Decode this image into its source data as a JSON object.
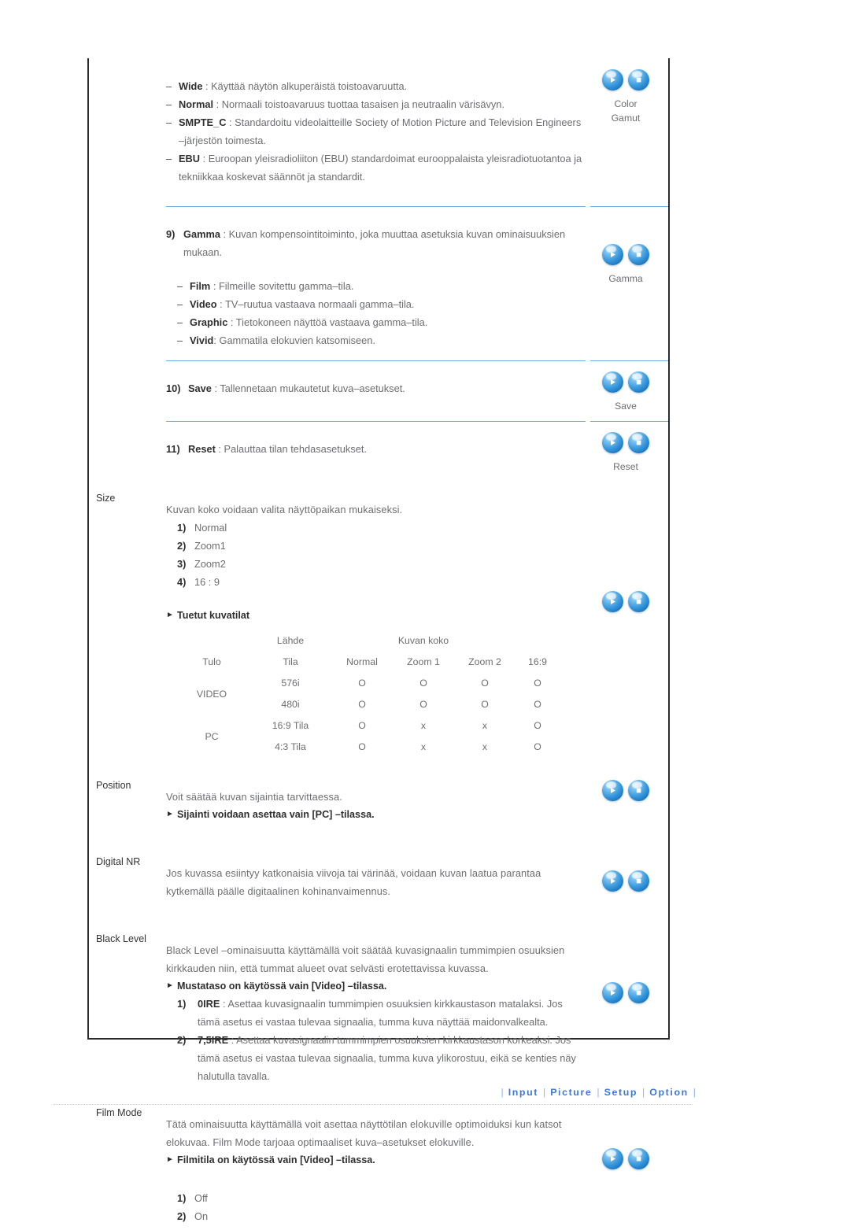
{
  "document": {
    "language": "fi",
    "accent_color": "#6aa9e9",
    "link_color": "#3c78d8"
  },
  "sections": [
    {
      "id": "color-gamut",
      "label": "",
      "icons": {
        "caption_line1": "Color",
        "caption_line2": "Gamut",
        "play": "play-icon",
        "stop": "stop-icon"
      },
      "items": [
        {
          "kind": "dash",
          "term": "Wide",
          "sep": " : ",
          "text": "Käyttää näytön alkuperäistä toistoavaruutta."
        },
        {
          "kind": "dash",
          "term": "Normal",
          "sep": " : ",
          "text": "Normaali toistoavaruus tuottaa tasaisen ja neutraalin värisävyn."
        },
        {
          "kind": "dash",
          "term": "SMPTE_C",
          "sep": " : ",
          "text": "Standardoitu videolaitteille Society of Motion Picture and Television Engineers –järjestön toimesta."
        },
        {
          "kind": "dash",
          "term": "EBU",
          "sep": " : ",
          "text": "Euroopan yleisradioliiton (EBU) standardoimat eurooppalaista yleisradiotuotantoa ja tekniikkaa koskevat säännöt ja standardit."
        }
      ]
    },
    {
      "id": "gamma",
      "label": "",
      "icons": {
        "caption_line1": "Gamma",
        "caption_line2": "",
        "play": "play-icon",
        "stop": "stop-icon"
      },
      "heading": {
        "num": "9)",
        "term": "Gamma",
        "sep": " : ",
        "text": "Kuvan kompensointitoiminto, joka muuttaa asetuksia kuvan ominaisuuksien mukaan."
      },
      "items": [
        {
          "kind": "dash",
          "term": "Film",
          "sep": " : ",
          "text": "Filmeille sovitettu gamma–tila."
        },
        {
          "kind": "dash",
          "term": "Video",
          "sep": " : ",
          "text": "TV–ruutua vastaava normaali gamma–tila."
        },
        {
          "kind": "dash",
          "term": "Graphic",
          "sep": " : ",
          "text": "Tietokoneen näyttöä vastaava gamma–tila."
        },
        {
          "kind": "dash",
          "term": "Vivid",
          "sep": ": ",
          "text": "Gammatila elokuvien katsomiseen."
        }
      ]
    },
    {
      "id": "save",
      "label": "",
      "icons": {
        "caption_line1": "Save",
        "caption_line2": "",
        "play": "play-icon",
        "stop": "stop-icon"
      },
      "heading": {
        "num": "10)",
        "term": "Save",
        "sep": " : ",
        "text": "Tallennetaan mukautetut kuva–asetukset."
      }
    },
    {
      "id": "reset",
      "label": "",
      "icons": {
        "caption_line1": "Reset",
        "caption_line2": "",
        "play": "play-icon",
        "stop": "stop-icon"
      },
      "heading": {
        "num": "11)",
        "term": "Reset",
        "sep": " : ",
        "text": "Palauttaa tilan tehdasasetukset."
      }
    },
    {
      "id": "size",
      "label": "Size",
      "icons": {
        "caption_line1": "",
        "caption_line2": "",
        "play": "play-icon",
        "stop": "stop-icon"
      },
      "intro": "Kuvan koko voidaan valita näyttöpaikan mukaiseksi.",
      "options": [
        {
          "num": "1)",
          "text": "Normal"
        },
        {
          "num": "2)",
          "text": "Zoom1"
        },
        {
          "num": "3)",
          "text": "Zoom2"
        },
        {
          "num": "4)",
          "text": "16 : 9"
        }
      ],
      "note": "Tuetut kuvatilat"
    },
    {
      "id": "position",
      "label": "Position",
      "icons": {
        "caption_line1": "",
        "caption_line2": "",
        "play": "play-icon",
        "stop": "stop-icon"
      },
      "intro": "Voit säätää kuvan sijaintia tarvittaessa.",
      "note": "Sijainti voidaan asettaa vain [PC] –tilassa."
    },
    {
      "id": "digital-nr",
      "label": "Digital NR",
      "icons": {
        "caption_line1": "",
        "caption_line2": "",
        "play": "play-icon",
        "stop": "stop-icon"
      },
      "intro": "Jos kuvassa esiintyy katkonaisia viivoja tai värinää, voidaan kuvan laatua parantaa kytkemällä päälle digitaalinen kohinanvaimennus."
    },
    {
      "id": "black-level",
      "label": "Black Level",
      "icons": {
        "caption_line1": "",
        "caption_line2": "",
        "play": "play-icon",
        "stop": "stop-icon"
      },
      "intro": "Black Level –ominaisuutta käyttämällä voit säätää kuvasignaalin tummimpien osuuksien kirkkauden niin, että tummat alueet ovat selvästi erotettavissa kuvassa.",
      "note": "Mustataso on käytössä vain [Video] –tilassa.",
      "options": [
        {
          "num": "1)",
          "term": "0IRE",
          "sep": " : ",
          "text": "Asettaa kuvasignaalin tummimpien osuuksien kirkkaustason matalaksi. Jos tämä asetus ei vastaa tulevaa signaalia, tumma kuva näyttää maidonvalkealta."
        },
        {
          "num": "2)",
          "term": "7,5IRE",
          "sep": " : ",
          "text": "Asettaa kuvasignaalin tummimpien osuuksien kirkkaustason korkeaksi. Jos tämä asetus ei vastaa tulevaa signaalia, tumma kuva ylikorostuu, eikä se kenties näy halutulla tavalla."
        }
      ]
    },
    {
      "id": "film-mode",
      "label": "Film Mode",
      "icons": {
        "caption_line1": "",
        "caption_line2": "",
        "play": "play-icon",
        "stop": "stop-icon"
      },
      "intro": "Tätä ominaisuutta käyttämällä voit asettaa näyttötilan elokuville optimoiduksi kun katsot elokuvaa. Film Mode tarjoaa optimaaliset kuva–asetukset elokuville.",
      "note": "Filmitila on käytössä vain [Video] –tilassa.",
      "options": [
        {
          "num": "1)",
          "text": "Off"
        },
        {
          "num": "2)",
          "text": "On"
        }
      ]
    }
  ],
  "modes_table": {
    "group_headers": {
      "source": "Lähde",
      "size": "Kuvan koko"
    },
    "columns": [
      "Tulo",
      "Tila",
      "Normal",
      "Zoom 1",
      "Zoom 2",
      "16:9"
    ],
    "rows": [
      {
        "input": "VIDEO",
        "input_span": true,
        "mode": "576i",
        "values": [
          "O",
          "O",
          "O",
          "O"
        ]
      },
      {
        "input": "",
        "input_span": false,
        "mode": "480i",
        "values": [
          "O",
          "O",
          "O",
          "O"
        ]
      },
      {
        "input": "PC",
        "input_span": true,
        "mode": "16:9 Tila",
        "values": [
          "O",
          "x",
          "x",
          "O"
        ]
      },
      {
        "input": "",
        "input_span": false,
        "mode": "4:3 Tila",
        "values": [
          "O",
          "x",
          "x",
          "O"
        ]
      }
    ]
  },
  "footer": {
    "sep": "|",
    "links": [
      {
        "label": "Input"
      },
      {
        "label": "Picture"
      },
      {
        "label": "Setup"
      },
      {
        "label": "Option"
      }
    ]
  }
}
